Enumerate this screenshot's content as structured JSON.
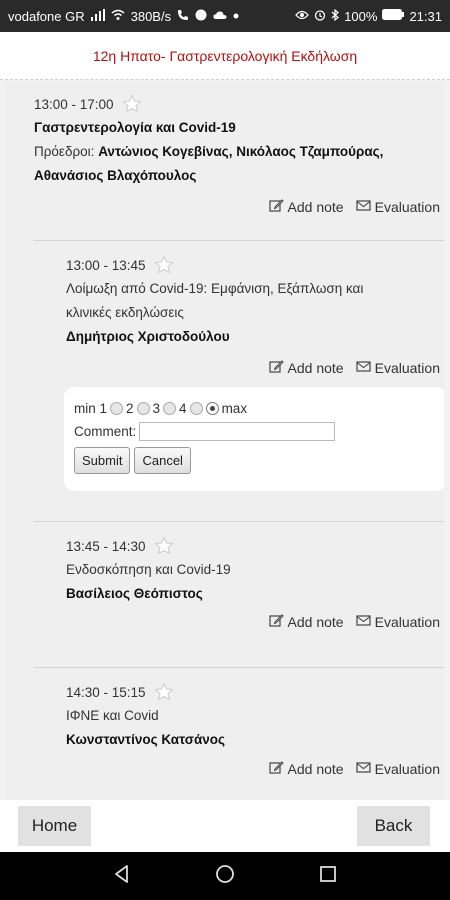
{
  "status_bar": {
    "carrier": "vodafone GR",
    "signal": "▮",
    "speed": "380B/s",
    "battery": "100%",
    "time": "21:31"
  },
  "header": {
    "title": "12η Ηπατο- Γαστρεντερολογική Εκδήλωση"
  },
  "session": {
    "time": "13:00  -  17:00",
    "title": "Γαστρεντερολογία και Covid-19",
    "chairs_label": "Πρόεδροι:",
    "chairs": "Αντώνιος Κογεβίνας, Νικόλαος Τζαμπούρας, Αθανάσιος Βλαχόπουλος",
    "add_note": "Add note",
    "evaluation": "Evaluation"
  },
  "talks": [
    {
      "time": "13:00  -  13:45",
      "title": "Λοίμωξη από Covid-19: Εμφάνιση, Εξάπλωση και κλινικές εκδηλώσεις",
      "speaker": "Δημήτριος Χριστοδούλου",
      "add_note": "Add note",
      "evaluation": "Evaluation"
    },
    {
      "time": "13:45  -  14:30",
      "title": "Ενδοσκόπηση και Covid-19",
      "speaker": "Βασίλειος Θεόπιστος",
      "add_note": "Add note",
      "evaluation": "Evaluation"
    },
    {
      "time": "14:30  -  15:15",
      "title": "ΙΦΝΕ και Covid",
      "speaker": "Κωνσταντίνος Κατσάνος",
      "add_note": "Add note",
      "evaluation": "Evaluation"
    }
  ],
  "evaluation_form": {
    "min_label": "min 1",
    "options": [
      "2",
      "3",
      "4"
    ],
    "max_label": "max",
    "selected": 5,
    "comment_label": "Comment:",
    "comment_value": "",
    "submit": "Submit",
    "cancel": "Cancel"
  },
  "bottom_nav": {
    "home": "Home",
    "back": "Back"
  },
  "colors": {
    "header_title": "#b01010",
    "status_bar": "#2a2a2a",
    "content_bg": "#efefef"
  }
}
